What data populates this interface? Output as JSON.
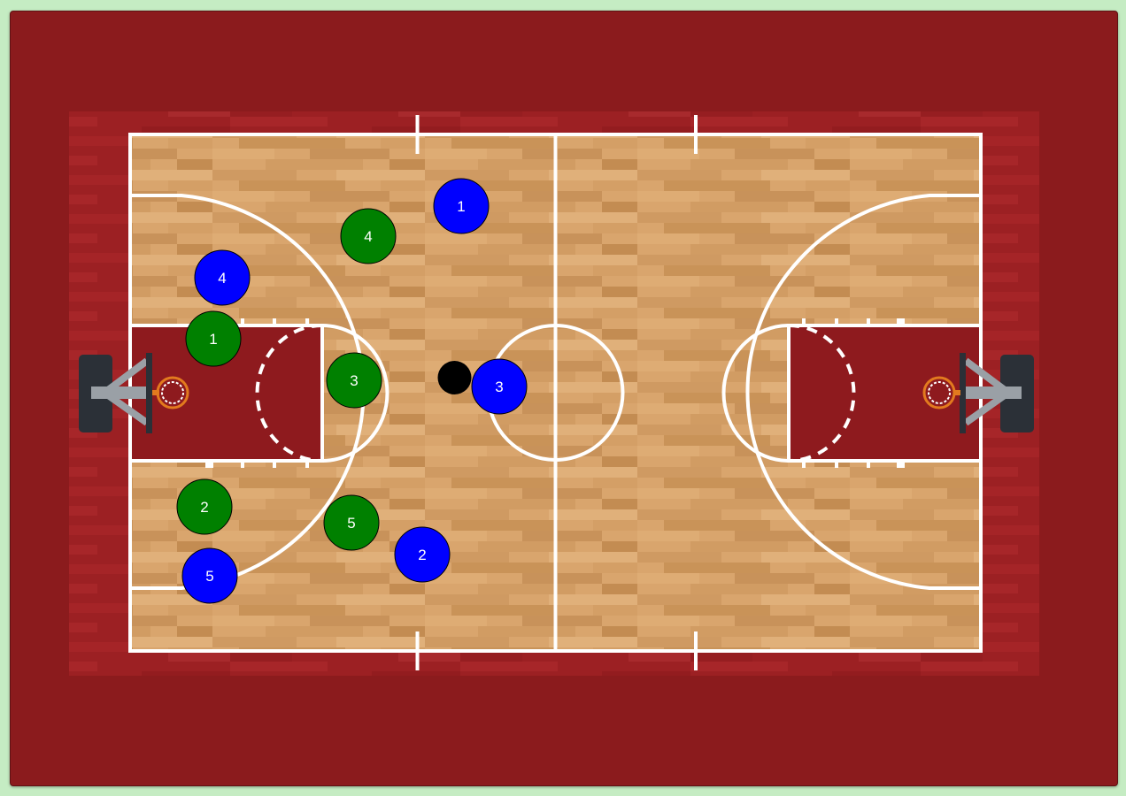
{
  "colors": {
    "page_background": "#c5ecc3",
    "arena_background": "#8b1b1d",
    "surround_floor": "#9e2225",
    "court_floor": "#d7a46c",
    "paint": "#8e1a1e",
    "lines": "#ffffff",
    "team_offense": "#0000ff",
    "team_defense": "#008000",
    "ball": "#000000",
    "rim": "#e27a1e",
    "backboard": "#2b3037",
    "stanchion_arm": "#9aa0a6"
  },
  "offense_team": {
    "color_name": "blue",
    "players": [
      {
        "number": "1"
      },
      {
        "number": "2"
      },
      {
        "number": "3"
      },
      {
        "number": "4"
      },
      {
        "number": "5"
      }
    ]
  },
  "defense_team": {
    "color_name": "green",
    "players": [
      {
        "number": "1"
      },
      {
        "number": "2"
      },
      {
        "number": "3"
      },
      {
        "number": "4"
      },
      {
        "number": "5"
      }
    ]
  },
  "ball": {
    "icon": "basketball-icon"
  },
  "icons": {
    "left_hoop": "hoop-icon",
    "right_hoop": "hoop-icon"
  }
}
